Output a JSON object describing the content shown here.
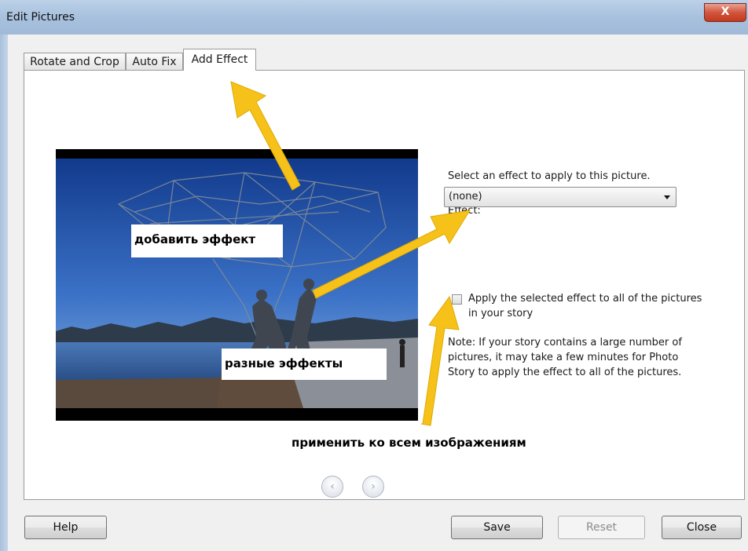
{
  "window": {
    "title": "Edit Pictures",
    "close_glyph": "X"
  },
  "tabs": [
    {
      "label": "Rotate and Crop",
      "active": false
    },
    {
      "label": "Auto Fix",
      "active": false
    },
    {
      "label": "Add Effect",
      "active": true
    }
  ],
  "effect_panel": {
    "instruction": "Select an effect to apply to this picture.",
    "effect_label": "Effect:",
    "effect_value": "(none)",
    "apply_all_line1": "Apply the selected effect to all of the pictures",
    "apply_all_line2": "in your story",
    "apply_all_checked": false,
    "note_line1": "Note: If your story contains a large number of",
    "note_line2": "pictures, it may take a few minutes for Photo",
    "note_line3": "Story to apply the effect to all of the pictures."
  },
  "annotations": {
    "add_effect": "добавить эффект",
    "different_effects": "разные эффекты",
    "apply_to_all": "применить ко всем изображениям",
    "arrow_color": "#f6c21a"
  },
  "navigation": {
    "prev_icon": "chevron-left-icon",
    "next_icon": "chevron-right-icon"
  },
  "buttons": {
    "help": "Help",
    "save": "Save",
    "reset": "Reset",
    "close": "Close"
  }
}
